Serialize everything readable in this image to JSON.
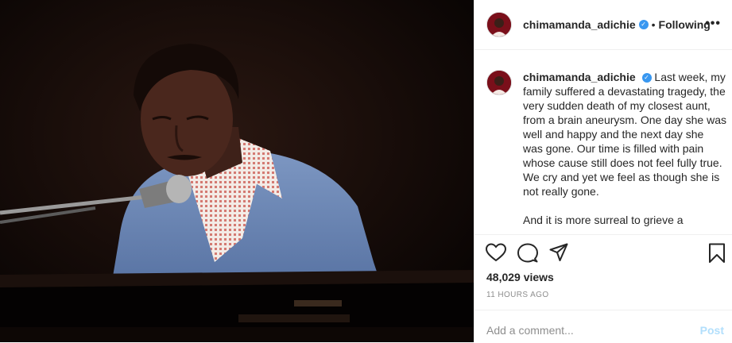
{
  "post": {
    "username": "chimamanda_adichie",
    "verified_mark": "✓",
    "separator": "•",
    "follow_status": "Following",
    "more_glyph": "•••"
  },
  "caption": {
    "username": "chimamanda_adichie",
    "paragraph1": "Last week, my family suffered a devastating tragedy, the very sudden death of my closest aunt, from a brain aneurysm. One day she was well and happy and the next day she was gone. Our time is filled with pain whose cause still does not feel fully true. We cry and yet we feel as though she is not really gone.",
    "paragraph2": "And it is more surreal to grieve a"
  },
  "icons": {
    "like": "heart-icon",
    "comment": "comment-icon",
    "share": "share-icon",
    "save": "bookmark-icon"
  },
  "stats": {
    "views": "48,029 views",
    "time": "11 HOURS AGO"
  },
  "comment": {
    "placeholder": "Add a comment...",
    "post_label": "Post"
  },
  "colors": {
    "verified": "#3897f0",
    "post_disabled": "#b2dffc",
    "meta_gray": "#8e8e8e"
  }
}
